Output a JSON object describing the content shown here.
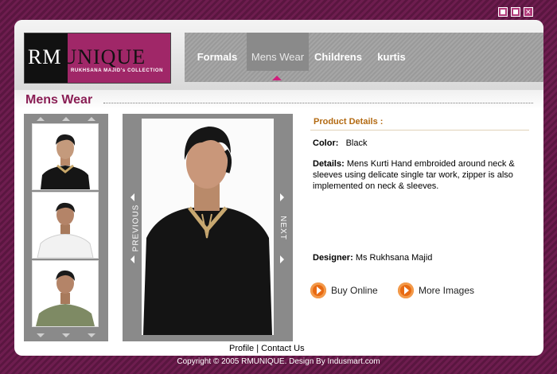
{
  "window_controls": [
    "minimize-icon",
    "maximize-icon",
    "close-icon"
  ],
  "logo": {
    "text_left": "RM",
    "text_right": "UNIQUE",
    "subtitle": "RUKHSANA MAJID's COLLECTION"
  },
  "nav": {
    "items": [
      {
        "label": "Formals"
      },
      {
        "label": "Mens Wear",
        "active": true
      },
      {
        "label": "Childrens"
      },
      {
        "label": "kurtis"
      }
    ]
  },
  "page": {
    "title": "Mens Wear"
  },
  "main_image": {
    "prev_label": "PREVIOUS",
    "next_label": "NEXT"
  },
  "product": {
    "heading": "Product Details :",
    "color_label": "Color:",
    "color_value": "Black",
    "details_label": "Details:",
    "details_value": "Mens Kurti Hand embroided around neck & sleeves using delicate single tar work, zipper is also implemented on neck & sleeves.",
    "designer_label": "Designer:",
    "designer_value": "Ms Rukhsana Majid"
  },
  "actions": {
    "buy": "Buy Online",
    "more": "More Images"
  },
  "footer": {
    "profile": "Profile",
    "separator": "|",
    "contact": "Contact Us",
    "copyright": "Copyright © 2005 RMUNIQUE. Design By Indusmart.com"
  },
  "colors": {
    "brand": "#a02768",
    "title": "#8a1f55",
    "accent": "#e86a12"
  }
}
